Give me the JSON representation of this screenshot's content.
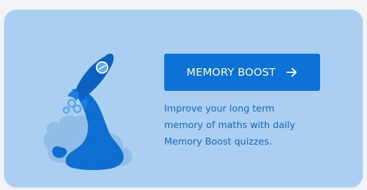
{
  "card": {
    "button_label": "MEMORY BOOST",
    "description_lines": [
      "Improve your long term",
      "memory of maths with daily",
      "Memory Boost quizzes."
    ]
  },
  "icons": {
    "illustration": "rocket-launch-illustration",
    "button_icon": "arrow-right-icon"
  },
  "colors": {
    "card_background": "#aacff0",
    "button_background": "#0d72d6",
    "button_text": "#ffffff",
    "description_text": "#1467c2"
  }
}
